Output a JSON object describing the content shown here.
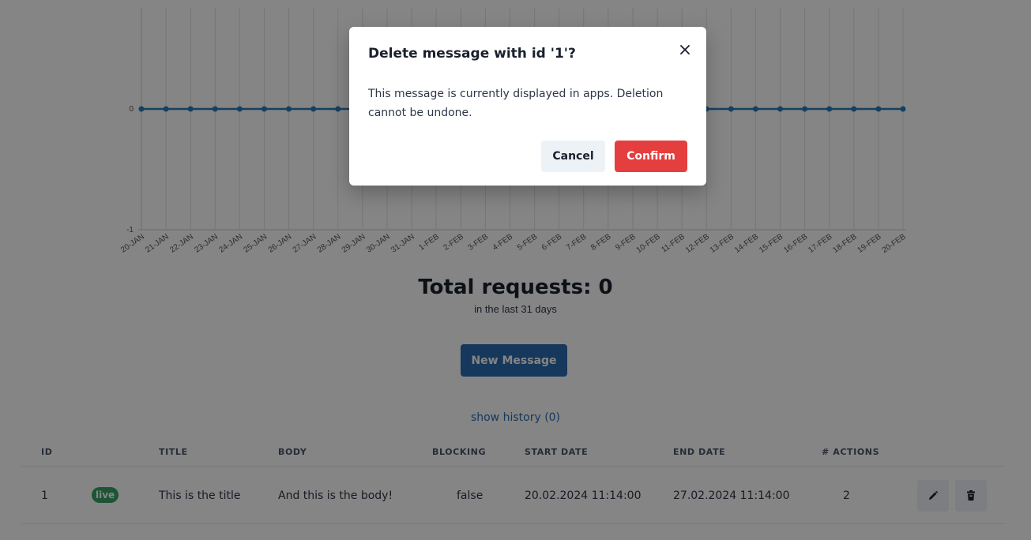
{
  "chart_data": {
    "type": "line",
    "x": [
      "20-JAN",
      "21-JAN",
      "22-JAN",
      "23-JAN",
      "24-JAN",
      "25-JAN",
      "26-JAN",
      "27-JAN",
      "28-JAN",
      "29-JAN",
      "30-JAN",
      "31-JAN",
      "1-FEB",
      "2-FEB",
      "3-FEB",
      "4-FEB",
      "5-FEB",
      "6-FEB",
      "7-FEB",
      "8-FEB",
      "9-FEB",
      "10-FEB",
      "11-FEB",
      "12-FEB",
      "13-FEB",
      "14-FEB",
      "15-FEB",
      "16-FEB",
      "17-FEB",
      "18-FEB",
      "19-FEB",
      "20-FEB"
    ],
    "values": [
      0,
      0,
      0,
      0,
      0,
      0,
      0,
      0,
      0,
      0,
      0,
      0,
      0,
      0,
      0,
      0,
      0,
      0,
      0,
      0,
      0,
      0,
      0,
      0,
      0,
      0,
      0,
      0,
      0,
      0,
      0,
      0
    ],
    "yticks": [
      "0",
      "-1"
    ],
    "ylim": [
      -1,
      0
    ],
    "grid": true,
    "color": "#2b7bb9"
  },
  "summary": {
    "total": "Total requests: 0",
    "period": "in the last 31 days"
  },
  "actions": {
    "new_message": "New Message",
    "show_history": "show history (0)"
  },
  "table": {
    "headers": {
      "id": "ID",
      "title": "TITLE",
      "body": "BODY",
      "blocking": "BLOCKING",
      "start_date": "START DATE",
      "end_date": "END DATE",
      "actions": "# ACTIONS"
    },
    "rows": [
      {
        "id": "1",
        "status": "live",
        "title": "This is the title",
        "body": "And this is the body!",
        "blocking": "false",
        "start_date": "20.02.2024 11:14:00",
        "end_date": "27.02.2024 11:14:00",
        "actions": "2"
      }
    ]
  },
  "icons": {
    "edit": "pencil-icon",
    "delete": "trash-icon",
    "close": "close-icon"
  },
  "colors": {
    "primary": "#2b6cb0",
    "danger": "#e53e3e",
    "live": "#38a169"
  },
  "modal": {
    "title": "Delete message with id '1'?",
    "body": "This message is currently displayed in apps. Deletion cannot be undone.",
    "cancel": "Cancel",
    "confirm": "Confirm"
  }
}
